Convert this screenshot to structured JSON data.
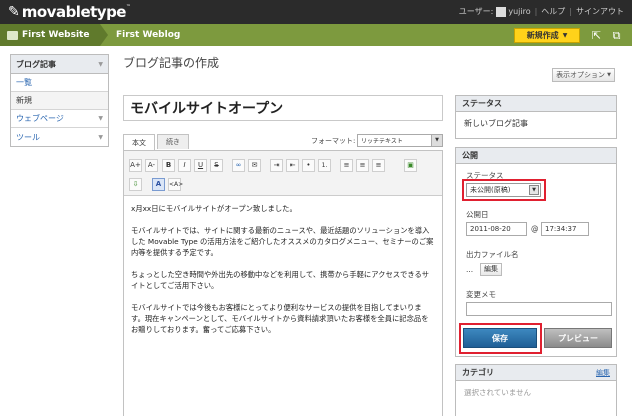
{
  "header": {
    "logo": "movabletype",
    "logo_tm": "™",
    "user_label": "ユーザー:",
    "username": "yujiro",
    "help": "ヘルプ",
    "signout": "サインアウト"
  },
  "crumbs": {
    "website": "First Website",
    "blog": "First Weblog",
    "new_button": "新規作成"
  },
  "sidebar": {
    "title": "ブログ記事",
    "items": [
      {
        "label": "一覧"
      },
      {
        "label": "新規"
      },
      {
        "label": "ウェブページ"
      },
      {
        "label": "ツール"
      }
    ]
  },
  "main": {
    "page_title": "ブログ記事の作成",
    "display_options": "表示オプション",
    "entry_title": "モバイルサイトオープン",
    "tabs": [
      {
        "label": "本文"
      },
      {
        "label": "続き"
      }
    ],
    "format_label": "フォーマット:",
    "format_value": "リッチテキスト",
    "toolbar": [
      "A+",
      "A-",
      "B",
      "I",
      "U",
      "S",
      "link",
      "mail",
      "≡",
      "≡",
      "•",
      "1.",
      "≡",
      "≡",
      "≡",
      "img",
      "file",
      "A",
      "</>"
    ],
    "body": [
      "x月xx日にモバイルサイトがオープン致しました。",
      "モバイルサイトでは、サイトに関する最新のニュースや、最近話題のソリューションを導入した Movable Type の活用方法をご紹介したオススメのカタログメニュー、セミナーのご案内等を提供する予定です。",
      "ちょっとした空き時間や外出先の移動中などを利用して、携帯から手軽にアクセスできるサイトとしてご活用下さい。",
      "モバイルサイトでは今後もお客様にとってより便利なサービスの提供を目指してまいります。現在キャンペーンとして、モバイルサイトから資料請求頂いたお客様を全員に記念品をお贈りしております。奮ってご応募下さい。"
    ]
  },
  "status_panel": {
    "title": "ステータス",
    "value": "新しいブログ記事"
  },
  "publish_panel": {
    "title": "公開",
    "status_label": "ステータス",
    "status_value": "未公開(原稿)",
    "date_label": "公開日",
    "date": "2011-08-20",
    "at": "@",
    "time": "17:34:37",
    "filename_label": "出力ファイル名",
    "filename_value": "...",
    "edit_button": "編集",
    "memo_label": "変更メモ",
    "memo_value": "",
    "save_button": "保存",
    "preview_button": "プレビュー"
  },
  "category_panel": {
    "title": "カテゴリ",
    "edit_link": "編集",
    "empty": "選択されていません"
  },
  "colors": {
    "topbar": "#2b2b2b",
    "crumbbar": "#7d9a3e",
    "accent": "#ffd21a",
    "save": "#2a70a8",
    "highlight": "#e02030"
  },
  "icons": {
    "new_caret": "chevron-down-icon",
    "share": "share-icon",
    "view_site": "external-link-icon"
  }
}
